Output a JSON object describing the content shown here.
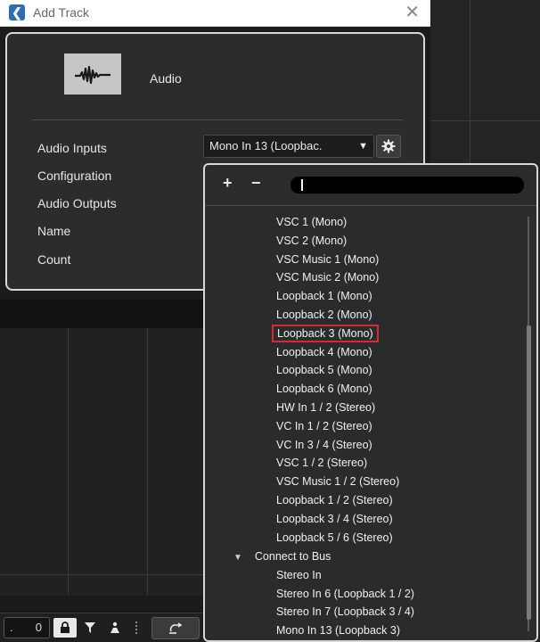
{
  "window": {
    "title": "Add Track",
    "close_glyph": "✕"
  },
  "dialog": {
    "track_type_label": "Audio",
    "fields": {
      "audio_inputs": "Audio Inputs",
      "configuration": "Configuration",
      "audio_outputs": "Audio Outputs",
      "name": "Name",
      "count": "Count"
    },
    "audio_inputs_value": "Mono In 13 (Loopbac.",
    "caret_glyph": "▼"
  },
  "dropdown": {
    "add_glyph": "+",
    "remove_glyph": "−",
    "items": [
      "VSC 1 (Mono)",
      "VSC 2 (Mono)",
      "VSC Music 1 (Mono)",
      "VSC Music 2 (Mono)",
      "Loopback 1 (Mono)",
      "Loopback 2 (Mono)",
      "Loopback 3 (Mono)",
      "Loopback 4 (Mono)",
      "Loopback 5 (Mono)",
      "Loopback 6 (Mono)",
      "HW In 1 / 2 (Stereo)",
      "VC In 1 / 2 (Stereo)",
      "VC In 3 / 4 (Stereo)",
      "VSC 1 / 2 (Stereo)",
      "VSC Music 1 / 2 (Stereo)",
      "Loopback 1 / 2 (Stereo)",
      "Loopback 3 / 4 (Stereo)",
      "Loopback 5 / 6 (Stereo)"
    ],
    "selected_item": "Loopback 3 (Mono)",
    "group_label": "Connect to Bus",
    "group_glyph": "▼",
    "bus_items": [
      "Stereo In",
      "Stereo In 6 (Loopback 1 / 2)",
      "Stereo In 7 (Loopback 3 / 4)",
      "Mono In 13 (Loopback 3)"
    ]
  },
  "bottom_toolbar": {
    "dot": ".",
    "value": "0"
  },
  "colors": {
    "selection_outline": "#d42c2c",
    "app_icon": "#2f6db3"
  },
  "icons": {
    "app": "cubase-icon",
    "audio": "waveform-icon",
    "settings": "gear-icon",
    "lock": "lock-icon",
    "filter": "filter-icon",
    "person": "person-icon",
    "loop": "loop-icon"
  }
}
